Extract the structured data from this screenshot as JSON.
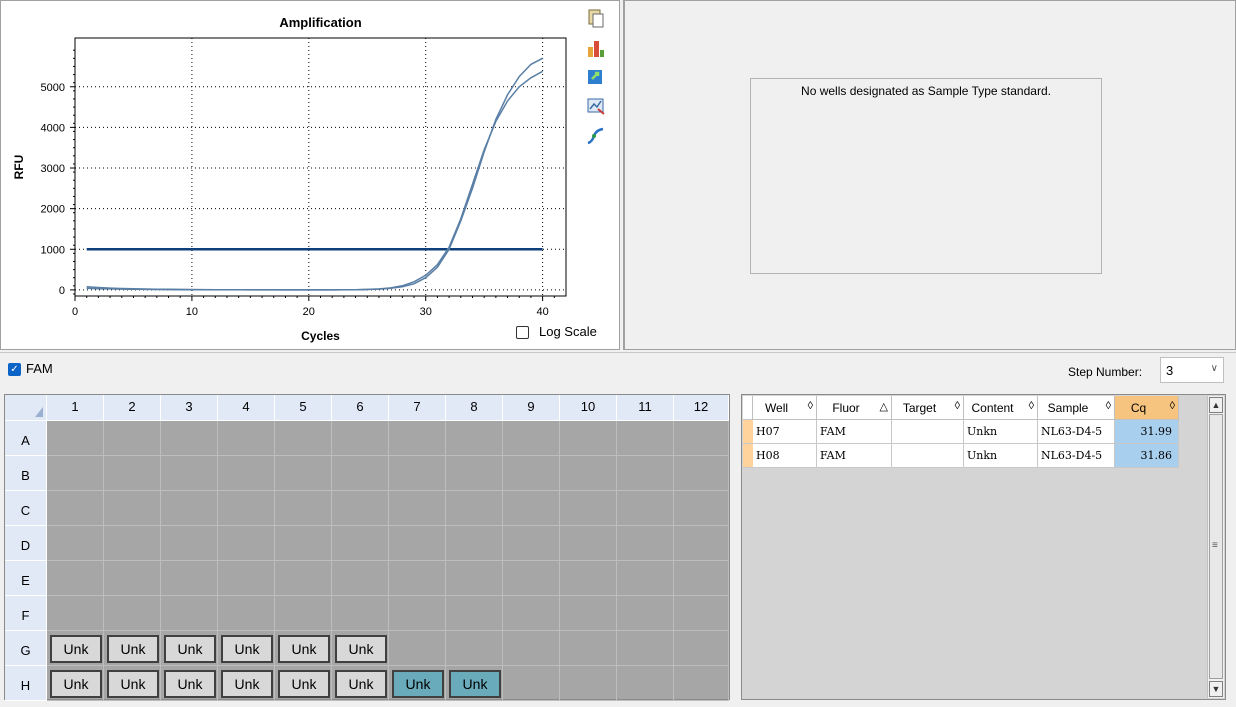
{
  "amplification": {
    "title": "Amplification",
    "xlabel": "Cycles",
    "ylabel": "RFU",
    "log_scale_label": "Log Scale",
    "log_scale_checked": false
  },
  "chart_data": {
    "type": "line",
    "title": "Amplification",
    "xlabel": "Cycles",
    "ylabel": "RFU",
    "xlim": [
      0,
      42
    ],
    "ylim": [
      -150,
      6200
    ],
    "x_ticks": [
      0,
      10,
      20,
      30,
      40
    ],
    "y_ticks": [
      0,
      1000,
      2000,
      3000,
      4000,
      5000
    ],
    "grid": true,
    "threshold": 1000,
    "series": [
      {
        "x": [
          1,
          2,
          3,
          4,
          5,
          6,
          7,
          8,
          9,
          10,
          11,
          12,
          13,
          14,
          15,
          16,
          17,
          18,
          19,
          20,
          21,
          22,
          23,
          24,
          25,
          26,
          27,
          28,
          29,
          30,
          31,
          32,
          33,
          34,
          35,
          36,
          37,
          38,
          39,
          40
        ],
        "values": [
          80,
          60,
          45,
          35,
          28,
          22,
          18,
          15,
          12,
          10,
          8,
          6,
          5,
          4,
          3,
          2,
          2,
          1,
          1,
          0,
          0,
          0,
          2,
          5,
          10,
          20,
          40,
          80,
          150,
          300,
          560,
          1000,
          1700,
          2500,
          3400,
          4200,
          4800,
          5250,
          5550,
          5700
        ]
      },
      {
        "x": [
          1,
          2,
          3,
          4,
          5,
          6,
          7,
          8,
          9,
          10,
          11,
          12,
          13,
          14,
          15,
          16,
          17,
          18,
          19,
          20,
          21,
          22,
          23,
          24,
          25,
          26,
          27,
          28,
          29,
          30,
          31,
          32,
          33,
          34,
          35,
          36,
          37,
          38,
          39,
          40
        ],
        "values": [
          40,
          30,
          25,
          20,
          15,
          12,
          10,
          8,
          6,
          5,
          4,
          3,
          2,
          2,
          1,
          1,
          0,
          0,
          0,
          0,
          0,
          0,
          2,
          6,
          12,
          25,
          50,
          100,
          200,
          360,
          620,
          1050,
          1750,
          2600,
          3450,
          4150,
          4650,
          5000,
          5220,
          5380
        ]
      }
    ]
  },
  "standard_curve": {
    "message": "No wells designated as Sample Type standard."
  },
  "toolbar": {
    "fluor_label": "FAM",
    "fluor_checked": true,
    "step_label": "Step Number:",
    "step_value": "3",
    "step_arrow": "∨"
  },
  "plate": {
    "corner": "",
    "columns": [
      "1",
      "2",
      "3",
      "4",
      "5",
      "6",
      "7",
      "8",
      "9",
      "10",
      "11",
      "12"
    ],
    "rows": [
      "A",
      "B",
      "C",
      "D",
      "E",
      "F",
      "G",
      "H"
    ],
    "wells": [
      {
        "row": "G",
        "col": 1,
        "label": "Unk",
        "selected": false
      },
      {
        "row": "G",
        "col": 2,
        "label": "Unk",
        "selected": false
      },
      {
        "row": "G",
        "col": 3,
        "label": "Unk",
        "selected": false
      },
      {
        "row": "G",
        "col": 4,
        "label": "Unk",
        "selected": false
      },
      {
        "row": "G",
        "col": 5,
        "label": "Unk",
        "selected": false
      },
      {
        "row": "G",
        "col": 6,
        "label": "Unk",
        "selected": false
      },
      {
        "row": "H",
        "col": 1,
        "label": "Unk",
        "selected": false
      },
      {
        "row": "H",
        "col": 2,
        "label": "Unk",
        "selected": false
      },
      {
        "row": "H",
        "col": 3,
        "label": "Unk",
        "selected": false
      },
      {
        "row": "H",
        "col": 4,
        "label": "Unk",
        "selected": false
      },
      {
        "row": "H",
        "col": 5,
        "label": "Unk",
        "selected": false
      },
      {
        "row": "H",
        "col": 6,
        "label": "Unk",
        "selected": false
      },
      {
        "row": "H",
        "col": 7,
        "label": "Unk",
        "selected": true
      },
      {
        "row": "H",
        "col": 8,
        "label": "Unk",
        "selected": true
      }
    ]
  },
  "results_table": {
    "columns": [
      {
        "key": "well",
        "label": "Well",
        "sort": "◊"
      },
      {
        "key": "fluor",
        "label": "Fluor",
        "sort": "△"
      },
      {
        "key": "target",
        "label": "Target",
        "sort": "◊"
      },
      {
        "key": "content",
        "label": "Content",
        "sort": "◊"
      },
      {
        "key": "sample",
        "label": "Sample",
        "sort": "◊"
      },
      {
        "key": "cq",
        "label": "Cq",
        "sort": "◊"
      }
    ],
    "rows": [
      {
        "well": "H07",
        "fluor": "FAM",
        "target": "",
        "content": "Unkn",
        "sample": "NL63-D4-5",
        "cq": "31.99"
      },
      {
        "well": "H08",
        "fluor": "FAM",
        "target": "",
        "content": "Unkn",
        "sample": "NL63-D4-5",
        "cq": "31.86"
      }
    ]
  },
  "icons": [
    "copy-icon",
    "chart-bars-icon",
    "export-icon",
    "graph-settings-icon",
    "curve-icon"
  ],
  "colors": {
    "curve": "#5a7fa6",
    "threshold": "#0e3f7a",
    "well_selected": "#69aabb",
    "cq_highlight": "#a9cfee",
    "cq_header": "#f6c47f"
  }
}
